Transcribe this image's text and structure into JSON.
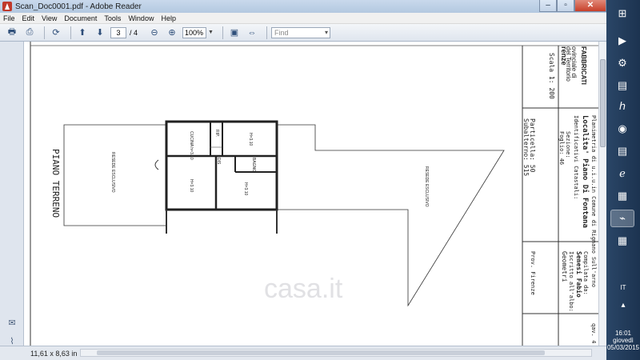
{
  "window": {
    "title": "Scan_Doc0001.pdf - Adobe Reader",
    "controls": {
      "minimize": "–",
      "maximize": "▫",
      "close": "✕"
    }
  },
  "menu": [
    "File",
    "Edit",
    "View",
    "Document",
    "Tools",
    "Window",
    "Help"
  ],
  "toolbar": {
    "page_current": "3",
    "page_total": "/ 4",
    "zoom": "100%",
    "find_placeholder": "Find"
  },
  "status": {
    "page_size": "11,61 x 8,63 in"
  },
  "document": {
    "scale": "Scala 1: 200",
    "header_lines": [
      "del Territorio",
      "FABBRICATI",
      "ovinciale di",
      "renze"
    ],
    "planimetria": "Planimetria di u.i.u.in Comune di Rignano Sull'arno",
    "localita": "Localita' Piano Di Fontana",
    "ident_title": "Identificativi Catastali:",
    "sezione": "Sezione:",
    "foglio": "Foglio: 46",
    "particella": "Particella: 50",
    "subalterno": "Subalterno: 515",
    "compilata": "Compilata da:",
    "nome": "Senesi Fabio",
    "iscritto": "Iscritto all'albo:",
    "albo": "Geometri",
    "prov": "Prov. Firenze",
    "qual": "qav. 4",
    "piano": "PIANO TERRENO",
    "corte_left": "RESEDE ESCLUSIVO",
    "corte_right": "RESEDE ESCLUSIVO",
    "rooms": {
      "cucina": "CUCINA h=3.10",
      "rip": "RIP.",
      "camera1": "H=3.10",
      "dis": "DIS",
      "bagno": "BAGNO",
      "camera2": "H=3.10",
      "camera3": "H=3.10"
    },
    "watermark": "casa.it"
  },
  "taskbar": {
    "lang": "IT",
    "time": "16:01",
    "day": "giovedì",
    "date": "05/03/2015"
  }
}
